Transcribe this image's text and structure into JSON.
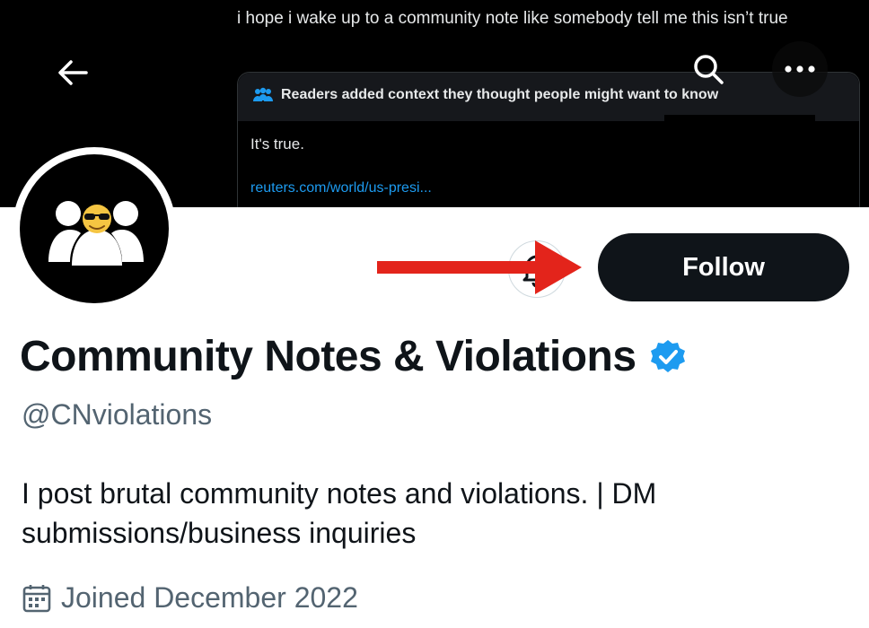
{
  "banner": {
    "tweet_text": "i hope i wake up to a community note like somebody tell me this isn’t true",
    "note_header": "Readers added context they thought people might want to know",
    "note_body": "It's true.",
    "note_link": "reuters.com/world/us-presi..."
  },
  "profile": {
    "follow_label": "Follow",
    "display_name": "Community Notes & Violations",
    "handle": "@CNviolations",
    "bio": "I post brutal community notes and violations. | DM submissions/business inquiries",
    "joined": "Joined December 2022"
  },
  "colors": {
    "link": "#1d9bf0",
    "verified": "#1d9bf0",
    "arrow": "#e3241b",
    "follow_bg": "#0f1419"
  },
  "icons": {
    "back": "arrow-left-icon",
    "search": "search-icon",
    "more": "more-icon",
    "notify": "bell-plus-icon",
    "verified": "verified-badge-icon",
    "calendar": "calendar-icon"
  }
}
